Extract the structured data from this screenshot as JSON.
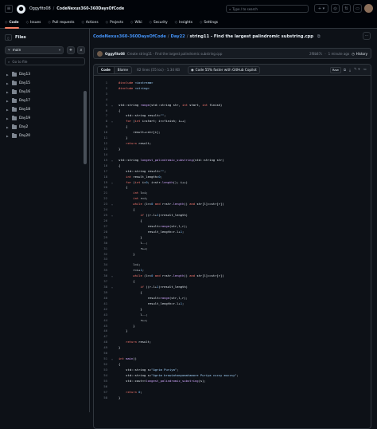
{
  "header": {
    "owner": "Oggyfito08",
    "repo": "CodeNexus360-360DaysOfCode",
    "search_placeholder": "Type / to search",
    "icons": [
      "menu-icon",
      "github-logo-icon",
      "search-icon",
      "plus-icon",
      "issues-icon",
      "pull-requests-icon",
      "inbox-icon"
    ]
  },
  "repo_tabs": [
    {
      "label": "Code",
      "icon": "code-icon",
      "active": true
    },
    {
      "label": "Issues",
      "icon": "issues-icon"
    },
    {
      "label": "Pull requests",
      "icon": "pull-request-icon"
    },
    {
      "label": "Actions",
      "icon": "actions-icon"
    },
    {
      "label": "Projects",
      "icon": "projects-icon"
    },
    {
      "label": "Wiki",
      "icon": "wiki-icon"
    },
    {
      "label": "Security",
      "icon": "shield-icon"
    },
    {
      "label": "Insights",
      "icon": "graph-icon"
    },
    {
      "label": "Settings",
      "icon": "gear-icon"
    }
  ],
  "sidebar": {
    "title": "Files",
    "branch": "main",
    "goto_placeholder": "Go to file",
    "items": [
      {
        "label": "Day13"
      },
      {
        "label": "Day15"
      },
      {
        "label": "Day16"
      },
      {
        "label": "Day17"
      },
      {
        "label": "Day18"
      },
      {
        "label": "Day19"
      },
      {
        "label": "Day2"
      },
      {
        "label": "Day20"
      }
    ]
  },
  "breadcrumb": {
    "repo": "CodeNexus360-360DaysOfCode",
    "folder": "Day22",
    "file": "string11 - Find the largest palindromic substring.cpp"
  },
  "commit": {
    "author": "Oggyfito08",
    "message": "Create string11 - Find the largest palindromic substring.cpp",
    "hash": "2f8b87c",
    "time": "1 minute ago",
    "history_label": "History"
  },
  "file_header": {
    "code_tab": "Code",
    "blame_tab": "Blame",
    "info": "62 lines (55 loc) · 1.34 KB",
    "copilot": "Code 55% faster with GitHub Copilot",
    "raw_label": "Raw"
  },
  "code_lines": [
    {
      "n": "1",
      "h": "<span class=\"pp\">#include</span> <span class=\"s\">&lt;iostream&gt;</span>"
    },
    {
      "n": "2",
      "h": "<span class=\"pp\">#include</span> <span class=\"s\">&lt;string&gt;</span>"
    },
    {
      "n": "3",
      "h": ""
    },
    {
      "n": "4",
      "h": ""
    },
    {
      "n": "5",
      "h": "std::string <span class=\"f\">range</span>(std::string str, <span class=\"k\">int</span> start, <span class=\"k\">int</span> finish)",
      "fold": true
    },
    {
      "n": "6",
      "h": "{"
    },
    {
      "n": "7",
      "h": "    std::string result=<span class=\"s\">\"\"</span>;"
    },
    {
      "n": "8",
      "h": "    <span class=\"k\">for</span> (<span class=\"k\">int</span> i=start; i&lt;=finish; i++)",
      "fold": true
    },
    {
      "n": "9",
      "h": "    {"
    },
    {
      "n": "10",
      "h": "        result+=str[i];"
    },
    {
      "n": "11",
      "h": "    }"
    },
    {
      "n": "12",
      "h": "    <span class=\"k\">return</span> result;"
    },
    {
      "n": "13",
      "h": "}"
    },
    {
      "n": "14",
      "h": ""
    },
    {
      "n": "15",
      "h": "std::string <span class=\"f\">longest_palindromic_substring</span>(std::string str)",
      "fold": true
    },
    {
      "n": "16",
      "h": "{"
    },
    {
      "n": "17",
      "h": "    std::string result=<span class=\"s\">\"\"</span>;"
    },
    {
      "n": "18",
      "h": "    <span class=\"k\">int</span> result_length=<span class=\"c\">0</span>;"
    },
    {
      "n": "19",
      "h": "    <span class=\"k\">for</span> (<span class=\"k\">int</span> i=<span class=\"c\">0</span>; i&lt;str.<span class=\"f\">length</span>(); i++)",
      "fold": true
    },
    {
      "n": "20",
      "h": "    {"
    },
    {
      "n": "21",
      "h": "        <span class=\"k\">int</span> l=i;"
    },
    {
      "n": "22",
      "h": "        <span class=\"k\">int</span> r=i;"
    },
    {
      "n": "23",
      "h": "        <span class=\"k\">while</span> (l&gt;=<span class=\"c\">0</span> <span class=\"k\">and</span> r&lt;str.<span class=\"f\">length</span>() <span class=\"k\">and</span> str[l]==str[r])",
      "fold": true
    },
    {
      "n": "24",
      "h": "        {"
    },
    {
      "n": "25",
      "h": "            <span class=\"k\">if</span> ((r-l+<span class=\"c\">1</span>)&gt;result_length)",
      "fold": true
    },
    {
      "n": "26",
      "h": "            {"
    },
    {
      "n": "27",
      "h": "                result=<span class=\"f\">range</span>(str,l,r);"
    },
    {
      "n": "28",
      "h": "                result_length=r-l+<span class=\"c\">1</span>;"
    },
    {
      "n": "29",
      "h": "            }"
    },
    {
      "n": "30",
      "h": "            l--;"
    },
    {
      "n": "31",
      "h": "            r++;"
    },
    {
      "n": "32",
      "h": "        }"
    },
    {
      "n": "33",
      "h": ""
    },
    {
      "n": "34",
      "h": "        l=i;"
    },
    {
      "n": "35",
      "h": "        r=i+<span class=\"c\">1</span>;"
    },
    {
      "n": "36",
      "h": "        <span class=\"k\">while</span> (l&gt;=<span class=\"c\">0</span> <span class=\"k\">and</span> r&lt;str.<span class=\"f\">length</span>() <span class=\"k\">and</span> str[l]==str[r])",
      "fold": true
    },
    {
      "n": "37",
      "h": "        {"
    },
    {
      "n": "38",
      "h": "            <span class=\"k\">if</span> ((r-l+<span class=\"c\">1</span>)&gt;result_length)",
      "fold": true
    },
    {
      "n": "39",
      "h": "            {"
    },
    {
      "n": "40",
      "h": "                result=<span class=\"f\">range</span>(str,l,r);"
    },
    {
      "n": "41",
      "h": "                result_length=r-l+<span class=\"c\">1</span>;"
    },
    {
      "n": "42",
      "h": "            }"
    },
    {
      "n": "43",
      "h": "            l--;"
    },
    {
      "n": "44",
      "h": "            r++;"
    },
    {
      "n": "45",
      "h": "        }"
    },
    {
      "n": "46",
      "h": "    }"
    },
    {
      "n": "47",
      "h": ""
    },
    {
      "n": "48",
      "h": "    <span class=\"k\">return</span> result;"
    },
    {
      "n": "49",
      "h": "}"
    },
    {
      "n": "50",
      "h": ""
    },
    {
      "n": "51",
      "h": "<span class=\"k\">int</span> <span class=\"f\">main</span>()",
      "fold": true
    },
    {
      "n": "52",
      "h": "{"
    },
    {
      "n": "53",
      "h": "    std::string s=<span class=\"s\">\"Agrim Puriya\"</span>;"
    },
    {
      "n": "54",
      "h": "    std::string s=<span class=\"s\">\"Agrim browiatomyomatamore Puriya cucsy muccsy\"</span>;"
    },
    {
      "n": "55",
      "h": "    std::cout&lt;&lt;<span class=\"f\">longest_palindromic_substring</span>(s);"
    },
    {
      "n": "56",
      "h": ""
    },
    {
      "n": "57",
      "h": "    <span class=\"k\">return</span> <span class=\"c\">0</span>;"
    },
    {
      "n": "58",
      "h": "}"
    }
  ]
}
